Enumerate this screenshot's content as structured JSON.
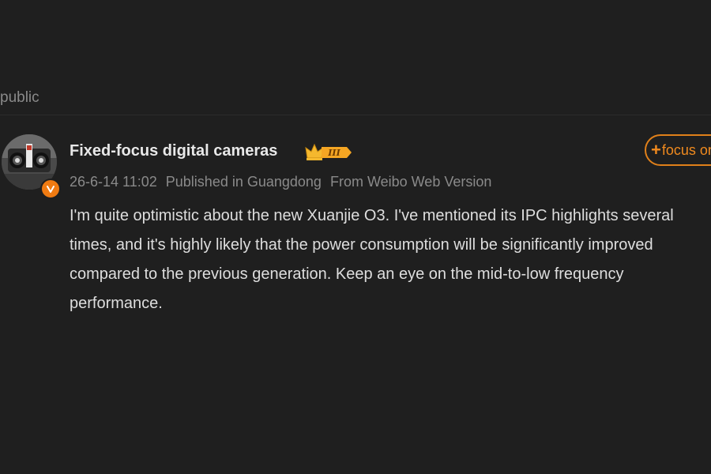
{
  "visibility": "public",
  "post": {
    "author": {
      "name": "Fixed-focus digital cameras",
      "avatar_icon": "camera-avatar",
      "verified_icon": "verified-badge-icon",
      "level_badge": "III"
    },
    "follow_label": "focus on",
    "follow_prefix": "+",
    "meta": {
      "time": "26-6-14 11:02",
      "location": "Published in Guangdong",
      "source": "From Weibo Web Version"
    },
    "text": "I'm quite optimistic about the new Xuanjie O3. I've mentioned its IPC highlights several times, and it's highly likely that the power consumption will be significantly improved compared to the previous generation. Keep an eye on the mid-to-low frequency performance."
  },
  "colors": {
    "background": "#1f1f1f",
    "accent": "#f08a1e",
    "muted_text": "#8a8a8a",
    "body_text": "#dedede"
  }
}
